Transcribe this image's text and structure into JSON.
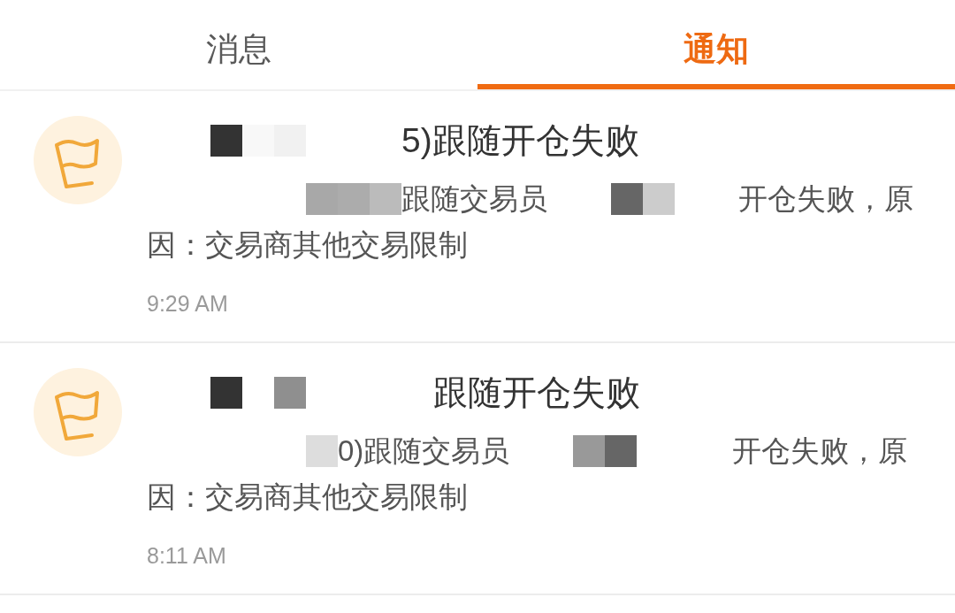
{
  "tabs": [
    {
      "label": "消息",
      "selected": false
    },
    {
      "label": "通知",
      "selected": true
    }
  ],
  "notifications": [
    {
      "title": [
        {
          "kind": "blank",
          "tiles": [
            {
              "color": "#ffffff"
            },
            {
              "color": "#ffffff"
            }
          ]
        },
        {
          "kind": "mosaic",
          "tiles": [
            {
              "color": "#333333"
            },
            {
              "color": "#f8f8f8"
            },
            {
              "color": "#f1f1f1"
            }
          ]
        },
        {
          "kind": "blank",
          "tiles": [
            {
              "color": "#ffffff"
            },
            {
              "color": "#ffffff"
            },
            {
              "color": "#ffffff"
            }
          ]
        },
        {
          "kind": "text",
          "text": "5)跟随开仓失败"
        }
      ],
      "body_lines": [
        [
          {
            "kind": "blank",
            "tiles": [
              {
                "color": "#ffffff"
              },
              {
                "color": "#ffffff"
              },
              {
                "color": "#ffffff"
              },
              {
                "color": "#ffffff"
              },
              {
                "color": "#ffffff"
              }
            ]
          },
          {
            "kind": "mosaic",
            "tiles": [
              {
                "color": "#a8a8a8"
              },
              {
                "color": "#acacac"
              },
              {
                "color": "#bbbbbb"
              }
            ]
          },
          {
            "kind": "text",
            "text": "跟随交易员"
          },
          {
            "kind": "blank",
            "tiles": [
              {
                "color": "#ffffff"
              },
              {
                "color": "#ffffff"
              }
            ]
          },
          {
            "kind": "mosaic",
            "tiles": [
              {
                "color": "#666666"
              },
              {
                "color": "#cccccc"
              }
            ]
          },
          {
            "kind": "blank",
            "tiles": [
              {
                "color": "#ffffff"
              },
              {
                "color": "#ffffff"
              }
            ]
          },
          {
            "kind": "text",
            "text": "开仓失败，原"
          }
        ],
        [
          {
            "kind": "text",
            "text": "因：交易商其他交易限制"
          }
        ]
      ],
      "time": "9:29 AM"
    },
    {
      "title": [
        {
          "kind": "blank",
          "tiles": [
            {
              "color": "#ffffff"
            },
            {
              "color": "#ffffff"
            }
          ]
        },
        {
          "kind": "mosaic",
          "tiles": [
            {
              "color": "#333333"
            },
            {
              "color": "#ffffff"
            },
            {
              "color": "#8f8f8f"
            }
          ]
        },
        {
          "kind": "blank",
          "tiles": [
            {
              "color": "#ffffff"
            },
            {
              "color": "#ffffff"
            },
            {
              "color": "#ffffff"
            },
            {
              "color": "#ffffff"
            }
          ]
        },
        {
          "kind": "text",
          "text": "跟随开仓失败"
        }
      ],
      "body_lines": [
        [
          {
            "kind": "blank",
            "tiles": [
              {
                "color": "#ffffff"
              },
              {
                "color": "#ffffff"
              },
              {
                "color": "#ffffff"
              },
              {
                "color": "#ffffff"
              },
              {
                "color": "#ffffff"
              }
            ]
          },
          {
            "kind": "mosaic",
            "tiles": [
              {
                "color": "#dddddd"
              }
            ]
          },
          {
            "kind": "text",
            "text": "0)跟随交易员"
          },
          {
            "kind": "blank",
            "tiles": [
              {
                "color": "#ffffff"
              },
              {
                "color": "#ffffff"
              }
            ]
          },
          {
            "kind": "mosaic",
            "tiles": [
              {
                "color": "#999999"
              },
              {
                "color": "#666666"
              }
            ]
          },
          {
            "kind": "blank",
            "tiles": [
              {
                "color": "#ffffff"
              },
              {
                "color": "#ffffff"
              },
              {
                "color": "#ffffff"
              }
            ]
          },
          {
            "kind": "text",
            "text": "开仓失败，原"
          }
        ],
        [
          {
            "kind": "text",
            "text": "因：交易商其他交易限制"
          }
        ]
      ],
      "time": "8:11 AM"
    }
  ]
}
